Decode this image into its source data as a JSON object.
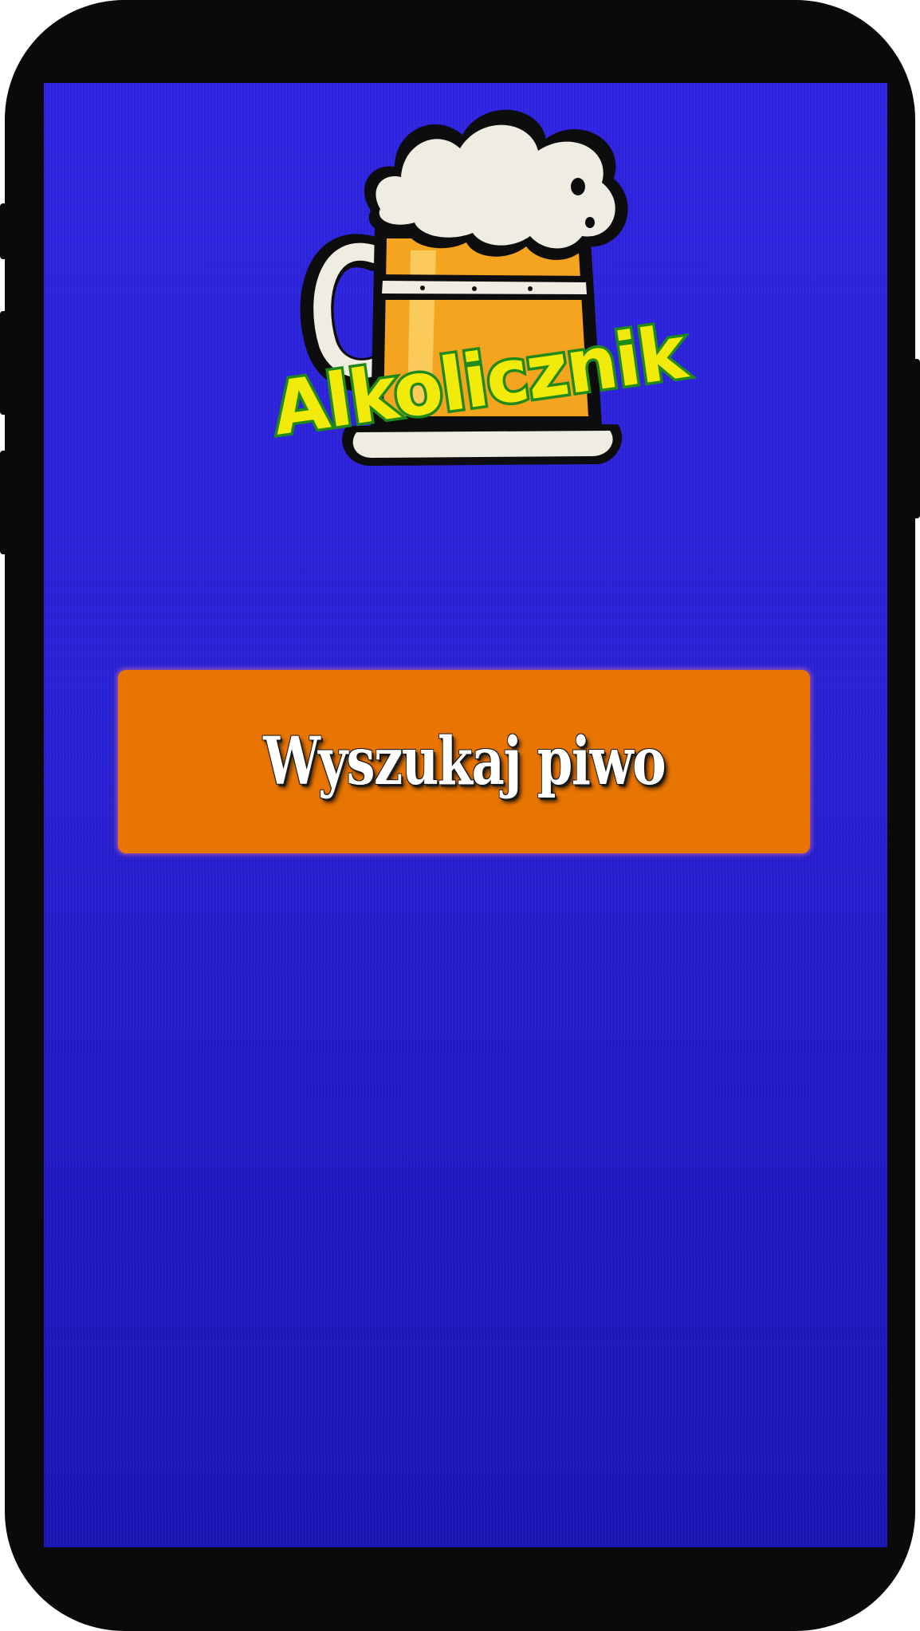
{
  "app": {
    "logo_text": "Alkolicznik",
    "logo_icon": "beer-mug-icon"
  },
  "main": {
    "search_button_label": "Wyszukaj piwo"
  },
  "colors": {
    "background": "#2a22d6",
    "button": "#e87502",
    "button_text": "#ffffff",
    "logo_text_fill": "#f2ea0a",
    "logo_text_outline": "#1f8a1a",
    "mug_body": "#f4a41e",
    "foam": "#efede2"
  }
}
